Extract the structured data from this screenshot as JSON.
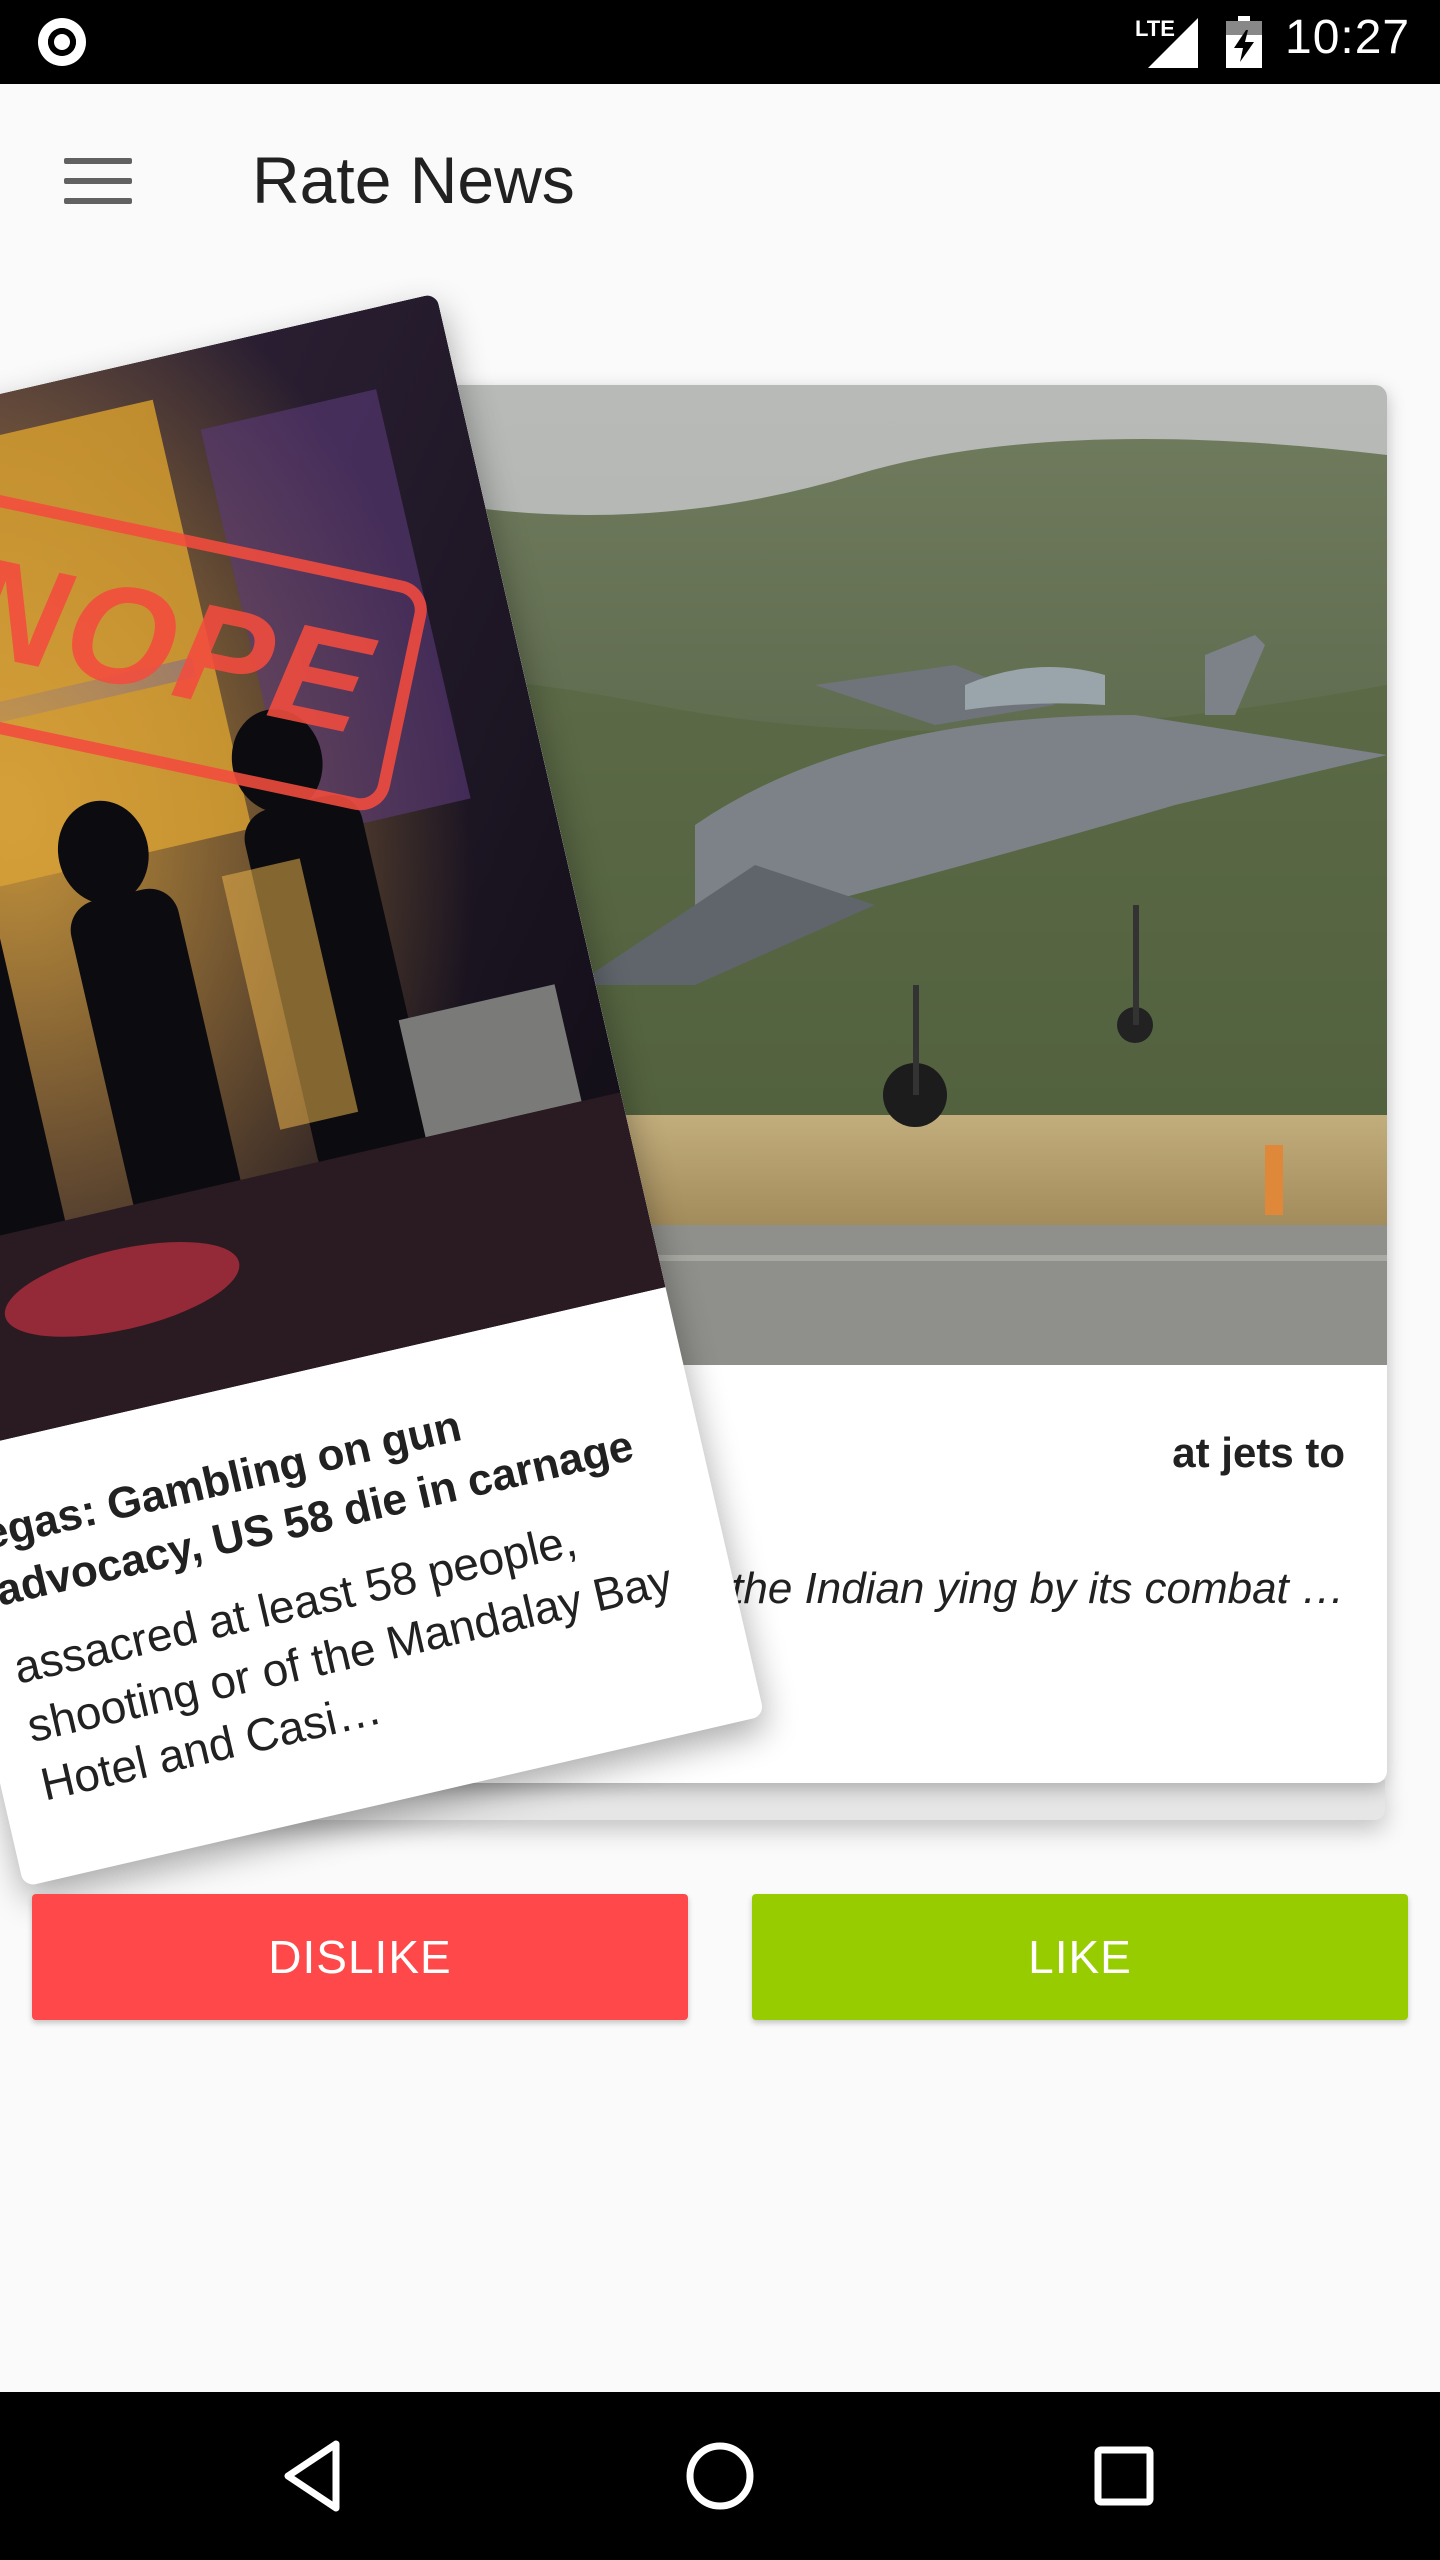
{
  "status_bar": {
    "network": "LTE",
    "time": "10:27"
  },
  "app_bar": {
    "title": "Rate News",
    "menu_icon": "hamburger-menu-icon"
  },
  "cards": {
    "front": {
      "headline": "egas: Gambling on gun advocacy, US 58 die in carnage",
      "summary": "assacred at least 58 people, shooting or of the Mandalay Bay Hotel and Casi…",
      "stamp": "NOPE",
      "stamp_color": "#f44c3e",
      "rotation_state": "swiped-left"
    },
    "back": {
      "headline": "at jets to",
      "summary": "ption, the Indian ying by its combat …"
    }
  },
  "actions": {
    "dislike_label": "DISLIKE",
    "like_label": "LIKE",
    "dislike_color": "#fe4849",
    "like_color": "#96cc00"
  },
  "nav_bar": {
    "back_icon": "back-triangle-icon",
    "home_icon": "home-circle-icon",
    "recents_icon": "recents-square-icon"
  }
}
